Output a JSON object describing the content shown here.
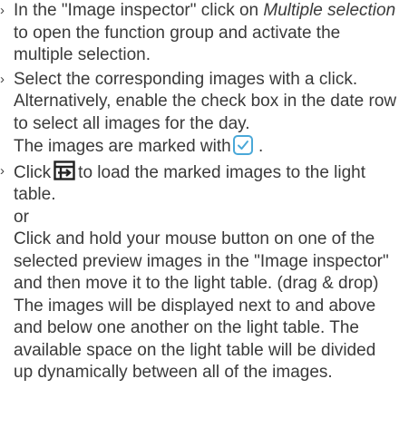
{
  "bullet_glyph": "›",
  "steps": [
    {
      "parts": {
        "a": "In the \"Image inspector\" click on ",
        "b": "Multiple selection",
        "c": " to open the function group and activate the multiple selection."
      }
    },
    {
      "parts": {
        "a": "Select the corresponding images with a click. Alternatively, enable the check box in the date row to select all images for the day.",
        "b": "The images are marked with",
        "c": "."
      },
      "icon": "checkbox-checked-icon"
    },
    {
      "parts": {
        "a": "Click",
        "b": "to load the marked images to the light table.",
        "or": "or",
        "c": "Click and hold your mouse button on one of the selected preview images in the \"Image inspector\" and then move it to the light table. (drag & drop)",
        "d": "The images will be displayed next to and above and below one another on the light table. The available space on the light table will be divided up dynamically between all of the images."
      },
      "icon": "load-to-light-table-icon"
    }
  ],
  "colors": {
    "text": "#3a3a3a",
    "icon_accent": "#4aa8d8",
    "icon_dark": "#222222"
  }
}
